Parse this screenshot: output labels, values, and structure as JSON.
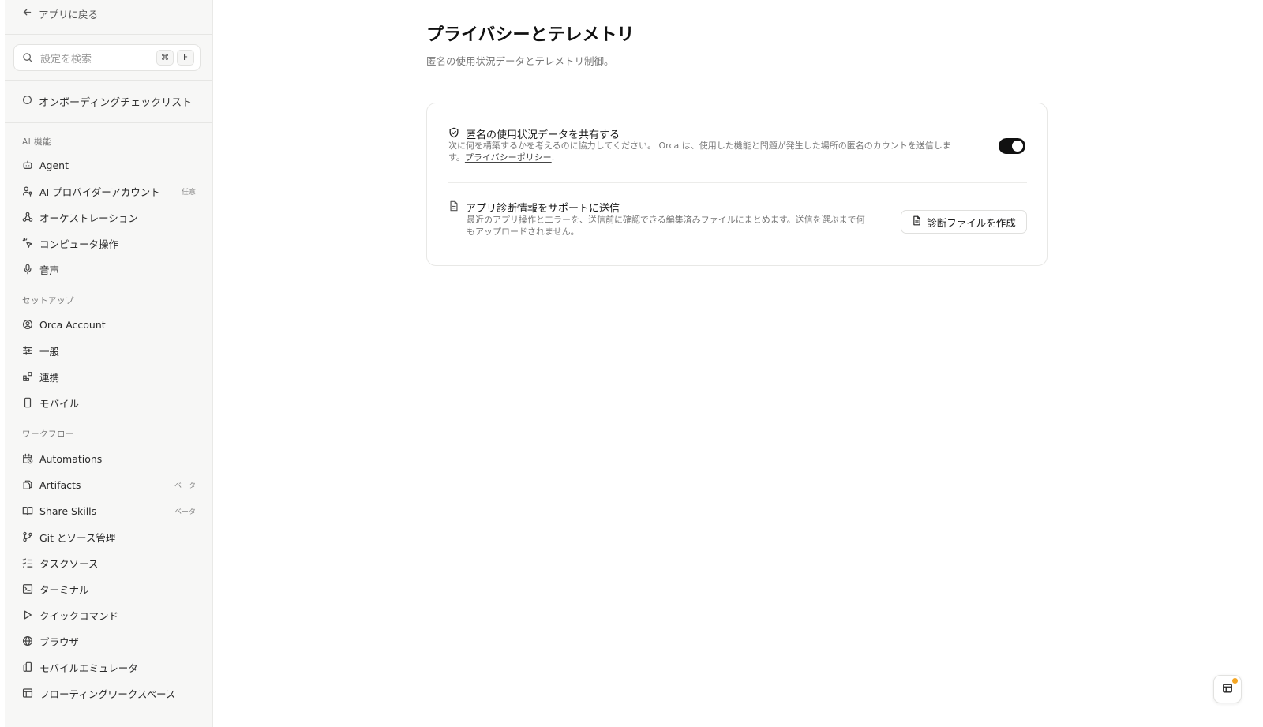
{
  "sidebar": {
    "back_label": "アプリに戻る",
    "search": {
      "placeholder": "設定を検索",
      "shortcut_key1": "⌘",
      "shortcut_key2": "F"
    },
    "onboarding_label": "オンボーディングチェックリスト",
    "sections": {
      "ai": "AI 機能",
      "setup": "セットアップ",
      "workflow": "ワークフロー"
    },
    "items": {
      "agent": {
        "label": "Agent"
      },
      "ai_provider": {
        "label": "AI プロバイダーアカウント",
        "badge": "任意"
      },
      "orchestration": {
        "label": "オーケストレーション"
      },
      "computer_use": {
        "label": "コンピュータ操作"
      },
      "voice": {
        "label": "音声"
      },
      "orca_account": {
        "label": "Orca Account"
      },
      "general": {
        "label": "一般"
      },
      "integrations": {
        "label": "連携"
      },
      "mobile": {
        "label": "モバイル"
      },
      "automations": {
        "label": "Automations"
      },
      "artifacts": {
        "label": "Artifacts",
        "badge": "ベータ"
      },
      "share_skills": {
        "label": "Share Skills",
        "badge": "ベータ"
      },
      "git": {
        "label": "Git とソース管理"
      },
      "task_sources": {
        "label": "タスクソース"
      },
      "terminal": {
        "label": "ターミナル"
      },
      "quick_commands": {
        "label": "クイックコマンド"
      },
      "browser": {
        "label": "ブラウザ"
      },
      "mobile_emulator": {
        "label": "モバイルエミュレータ"
      },
      "floating_workspace": {
        "label": "フローティングワークスペース"
      }
    }
  },
  "page": {
    "title": "プライバシーとテレメトリ",
    "subtitle": "匿名の使用状況データとテレメトリ制御。",
    "telemetry": {
      "title": "匿名の使用状況データを共有する",
      "desc_line1": "次に何を構築するかを考えるのに協力してください。 Orca は、使用した機能と問題が発生した場所の匿名のカウントを送信しま",
      "desc_line2_prefix": "す。",
      "privacy_link": "プライバシーポリシー",
      "desc_line2_suffix": ".",
      "enabled": true
    },
    "diagnostics": {
      "title": "アプリ診断情報をサポートに送信",
      "desc_line1": "最近のアプリ操作とエラーを、送信前に確認できる編集済みファイルにまとめます。送信を選ぶまで何",
      "desc_line2": "もアップロードされません。",
      "button_label": "診断ファイルを作成"
    }
  },
  "colors": {
    "toggle_on": "#111111",
    "notification_dot": "#f5a623"
  }
}
